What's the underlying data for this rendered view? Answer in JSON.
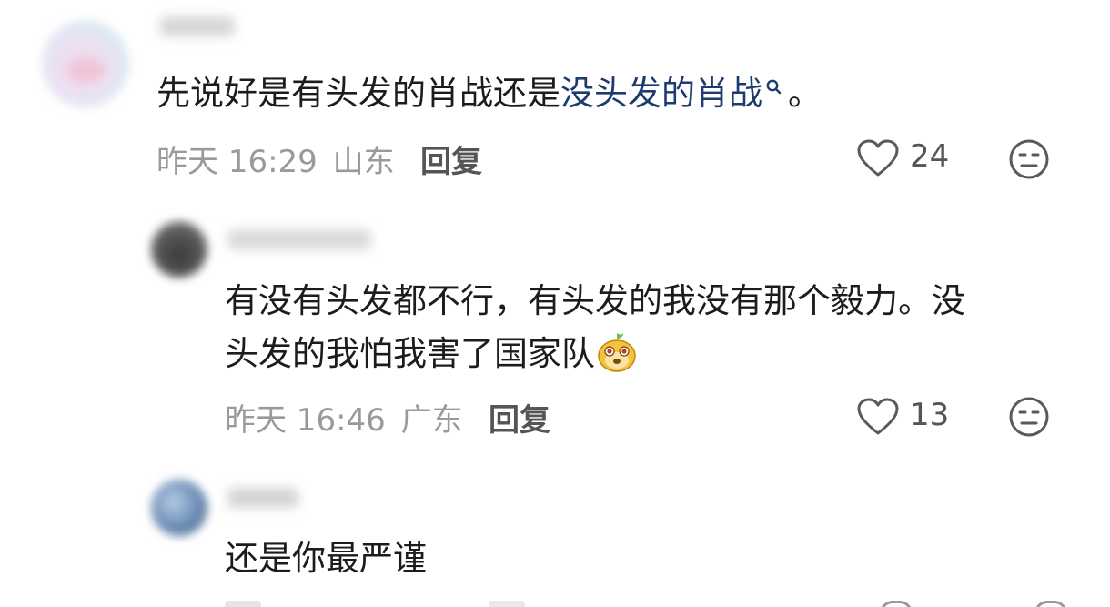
{
  "comments": [
    {
      "text": "先说好是有头发的肖战还是",
      "link": "没头发的肖战",
      "suffix": "。",
      "time": "昨天 16:29",
      "location": "山东",
      "reply_label": "回复",
      "likes": "24",
      "like_icon": "heart-outline-icon",
      "dislike_icon": "meh-face-icon"
    },
    {
      "text_line1": "有没有头发都不行，有头发的我没有那个毅力。没",
      "text_line2": "头发的我怕我害了国家队",
      "emoji": "yellow-mascot-emoji",
      "time": "昨天 16:46",
      "location": "广东",
      "reply_label": "回复",
      "likes": "13",
      "like_icon": "heart-outline-icon",
      "dislike_icon": "meh-face-icon"
    },
    {
      "text": "还是你最严谨"
    }
  ]
}
